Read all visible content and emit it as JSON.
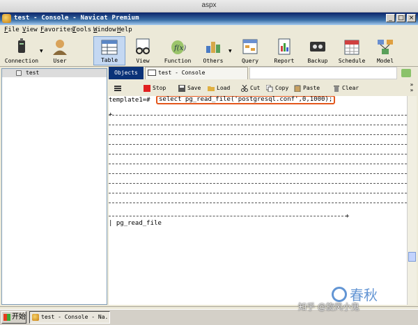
{
  "mac_window": {
    "title": "aspx"
  },
  "window": {
    "title": "test - Console - Navicat Premium",
    "buttons": {
      "minimize": "_",
      "maximize": "□",
      "close": "×"
    }
  },
  "menu": [
    "File",
    "View",
    "Favorites",
    "Tools",
    "Window",
    "Help"
  ],
  "toolbar": [
    {
      "label": "Connection",
      "icon": "connection-icon"
    },
    {
      "label": "User",
      "icon": "user-icon"
    },
    {
      "label": "Table",
      "icon": "table-icon",
      "active": true
    },
    {
      "label": "View",
      "icon": "view-icon"
    },
    {
      "label": "Function",
      "icon": "function-icon"
    },
    {
      "label": "Others",
      "icon": "others-icon"
    },
    {
      "label": "Query",
      "icon": "query-icon"
    },
    {
      "label": "Report",
      "icon": "report-icon"
    },
    {
      "label": "Backup",
      "icon": "backup-icon"
    },
    {
      "label": "Schedule",
      "icon": "schedule-icon"
    },
    {
      "label": "Model",
      "icon": "model-icon"
    }
  ],
  "tree": {
    "items": [
      {
        "label": "test"
      }
    ]
  },
  "tabs": {
    "objects": "Objects",
    "console": "test - Console"
  },
  "console_toolbar": {
    "stop": "Stop",
    "save": "Save",
    "load": "Load",
    "cut": "Cut",
    "copy": "Copy",
    "paste": "Paste",
    "clear": "Clear"
  },
  "console": {
    "prompt": "template1=#",
    "command": "select pg_read_file('postgresql.conf',0,1000);",
    "plus_left": "+",
    "plus_right": "+",
    "column_header": "| pg_read_file"
  },
  "collapse": {
    "arrows": "»"
  },
  "taskbar": {
    "start": "开始",
    "task": "test - Console - Na..."
  },
  "watermark": {
    "brand": "春秋",
    "credit": "知乎 @旋风小鬼"
  },
  "colors": {
    "highlight_box": "#e3561b",
    "title_bar": "#0a246a",
    "objects_tab": "#0a3278"
  }
}
